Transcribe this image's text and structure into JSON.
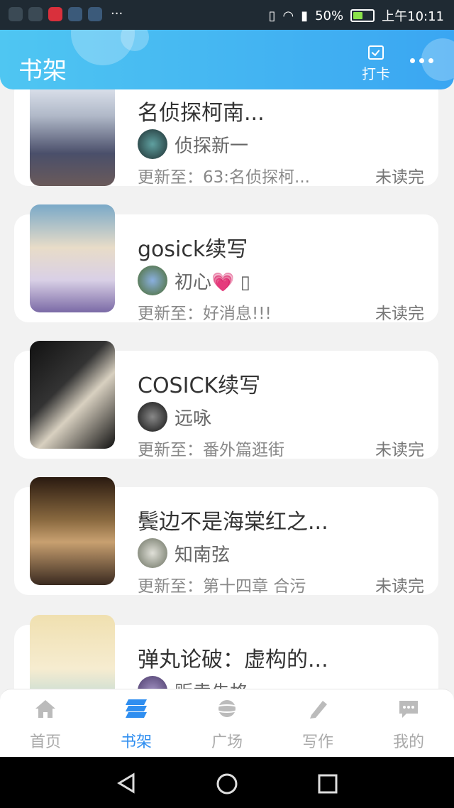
{
  "status_bar": {
    "battery_percent": 50,
    "battery": "50%",
    "time": "上午10:11",
    "overflow": "···"
  },
  "header": {
    "title": "书架",
    "checkin_label": "打卡"
  },
  "books": [
    {
      "title": "名侦探柯南...",
      "author": "侦探新一",
      "update": "更新至：63:名侦探柯...",
      "status": "未读完"
    },
    {
      "title": "gosick续写",
      "author": "初心💗 ▯",
      "update": "更新至：好消息!!!",
      "status": "未读完"
    },
    {
      "title": "COSICK续写",
      "author": "远咏",
      "update": "更新至：番外篇逛街",
      "status": "未读完"
    },
    {
      "title": "鬓边不是海棠红之...",
      "author": "知南弦",
      "update": "更新至：第十四章 合污",
      "status": "未读完"
    },
    {
      "title": "弹丸论破：虚构的...",
      "author": "贩卖先格",
      "update": "",
      "status": ""
    }
  ],
  "tabs": [
    {
      "label": "首页",
      "icon": "home-icon",
      "active": false
    },
    {
      "label": "书架",
      "icon": "bookshelf-icon",
      "active": true
    },
    {
      "label": "广场",
      "icon": "planet-icon",
      "active": false
    },
    {
      "label": "写作",
      "icon": "pen-icon",
      "active": false
    },
    {
      "label": "我的",
      "icon": "chat-icon",
      "active": false
    }
  ],
  "colors": {
    "accent": "#2f8ef0",
    "header_start": "#4fc6f2",
    "header_end": "#3aa6f2",
    "background": "#f2f2f2"
  }
}
